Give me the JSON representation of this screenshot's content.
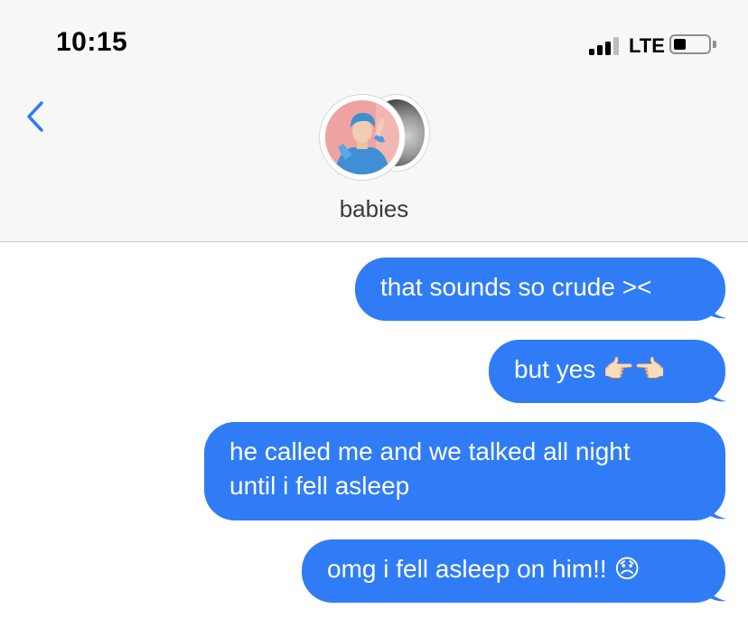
{
  "status_bar": {
    "time": "10:15",
    "network": "LTE",
    "signal_bars_active": 3,
    "signal_bars_total": 4,
    "battery_level": 0.35
  },
  "nav": {
    "back_icon": "chevron-left-icon",
    "contact_name": "babies"
  },
  "colors": {
    "accent": "#2f7cf6",
    "bubble_text": "#ffffff",
    "header_bg": "#f7f7f7"
  },
  "messages": [
    {
      "sender": "me",
      "lines": [
        "that sounds so crude ><"
      ]
    },
    {
      "sender": "me",
      "lines": [
        "but yes 👉🏻👈🏻"
      ]
    },
    {
      "sender": "me",
      "lines": [
        "he called me and we talked all night",
        "until i fell asleep"
      ]
    },
    {
      "sender": "me",
      "lines": [
        "omg i fell asleep on him!! 😞"
      ]
    }
  ]
}
